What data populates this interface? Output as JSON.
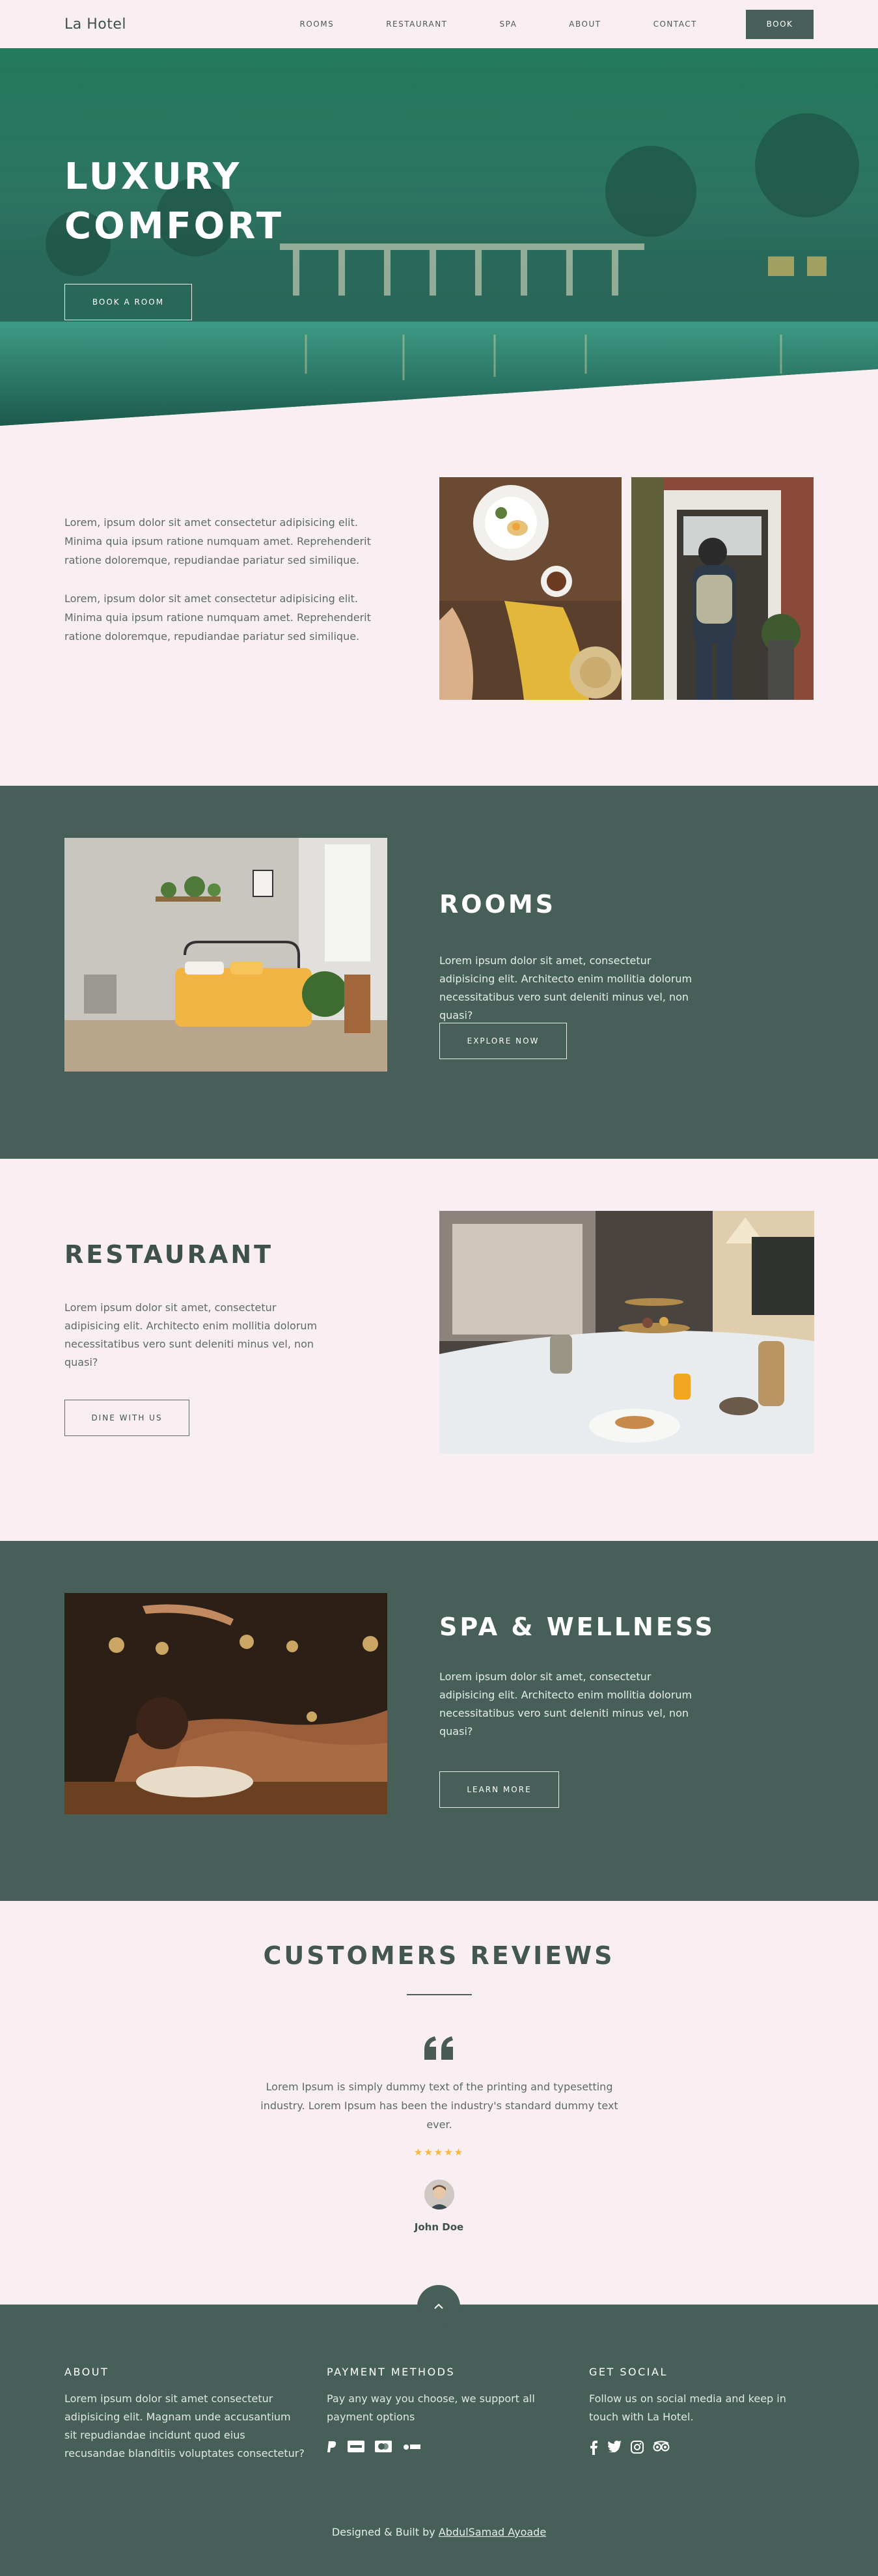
{
  "nav": {
    "brand": "La Hotel",
    "links": [
      "ROOMS",
      "RESTAURANT",
      "SPA",
      "ABOUT",
      "CONTACT"
    ],
    "book": "BOOK"
  },
  "hero": {
    "title_line1": "LUXURY",
    "title_line2": "COMFORT",
    "button": "BOOK A ROOM"
  },
  "intro": {
    "paragraphs": [
      "Lorem, ipsum dolor sit amet consectetur adipisicing elit. Minima quia ipsum ratione numquam amet. Reprehenderit ratione doloremque, repudiandae pariatur sed similique.",
      "Lorem, ipsum dolor sit amet consectetur adipisicing elit. Minima quia ipsum ratione numquam amet. Reprehenderit ratione doloremque, repudiandae pariatur sed similique."
    ]
  },
  "rooms": {
    "title": "ROOMS",
    "text": "Lorem ipsum dolor sit amet, consectetur adipisicing elit. Architecto enim mollitia dolorum necessitatibus vero sunt deleniti minus vel, non quasi?",
    "button": "EXPLORE NOW"
  },
  "restaurant": {
    "title": "RESTAURANT",
    "text": "Lorem ipsum dolor sit amet, consectetur adipisicing elit. Architecto enim mollitia dolorum necessitatibus vero sunt deleniti minus vel, non quasi?",
    "button": "DINE WITH US"
  },
  "spa": {
    "title": "SPA & WELLNESS",
    "text": "Lorem ipsum dolor sit amet, consectetur adipisicing elit. Architecto enim mollitia dolorum necessitatibus vero sunt deleniti minus vel, non quasi?",
    "button": "LEARN MORE"
  },
  "reviews": {
    "title": "CUSTOMERS REVIEWS",
    "quote": "Lorem Ipsum is simply dummy text of the printing and typesetting industry. Lorem Ipsum has been the industry's standard dummy text ever.",
    "stars": "★★★★★",
    "rating": 5,
    "reviewer": "John Doe"
  },
  "footer": {
    "about_title": "ABOUT",
    "about_text": "Lorem ipsum dolor sit amet consectetur adipisicing elit. Magnam unde accusantium sit repudiandae incidunt quod eius recusandae blanditiis voluptates consectetur?",
    "payment_title": "PAYMENT METHODS",
    "payment_text": "Pay any way you choose, we support all payment options",
    "payment_icons": [
      "paypal-icon",
      "visa-icon",
      "mastercard-icon",
      "apple-pay-icon"
    ],
    "social_title": "GET SOCIAL",
    "social_text": "Follow us on social media and keep in touch with La Hotel.",
    "social_icons": [
      "facebook-icon",
      "twitter-icon",
      "instagram-icon",
      "tripadvisor-icon"
    ],
    "credit_prefix": "Designed & Built by",
    "credit_name": "AbdulSamad Ayoade"
  },
  "colors": {
    "background": "#f9eff3",
    "primary": "#465f58",
    "hero_green": "#237a5c",
    "star": "#f4b740"
  }
}
